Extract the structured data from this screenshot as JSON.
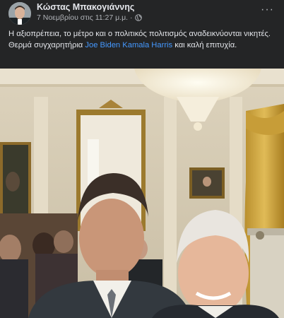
{
  "post": {
    "author": "Κώστας Μπακογιάννης",
    "timestamp": "7 Νοεμβρίου στις 11:27 μ.μ.",
    "separator": "·",
    "privacy_icon": "globe-icon",
    "more_icon": "more-options-icon",
    "more_label": "···",
    "text_line1": "Η αξιοπρέπεια, το μέτρο και ο πολιτικός πολιτισμός αναδεικνύονται νικητές. Θερμά συγχαρητήρια ",
    "tag1": "Joe Biden",
    "tag2": "Kamala Harris",
    "text_end": " και καλή επιτυχία."
  },
  "colors": {
    "background": "#242526",
    "text": "#e4e6eb",
    "secondary_text": "#b0b3b8",
    "link": "#4599ff"
  }
}
